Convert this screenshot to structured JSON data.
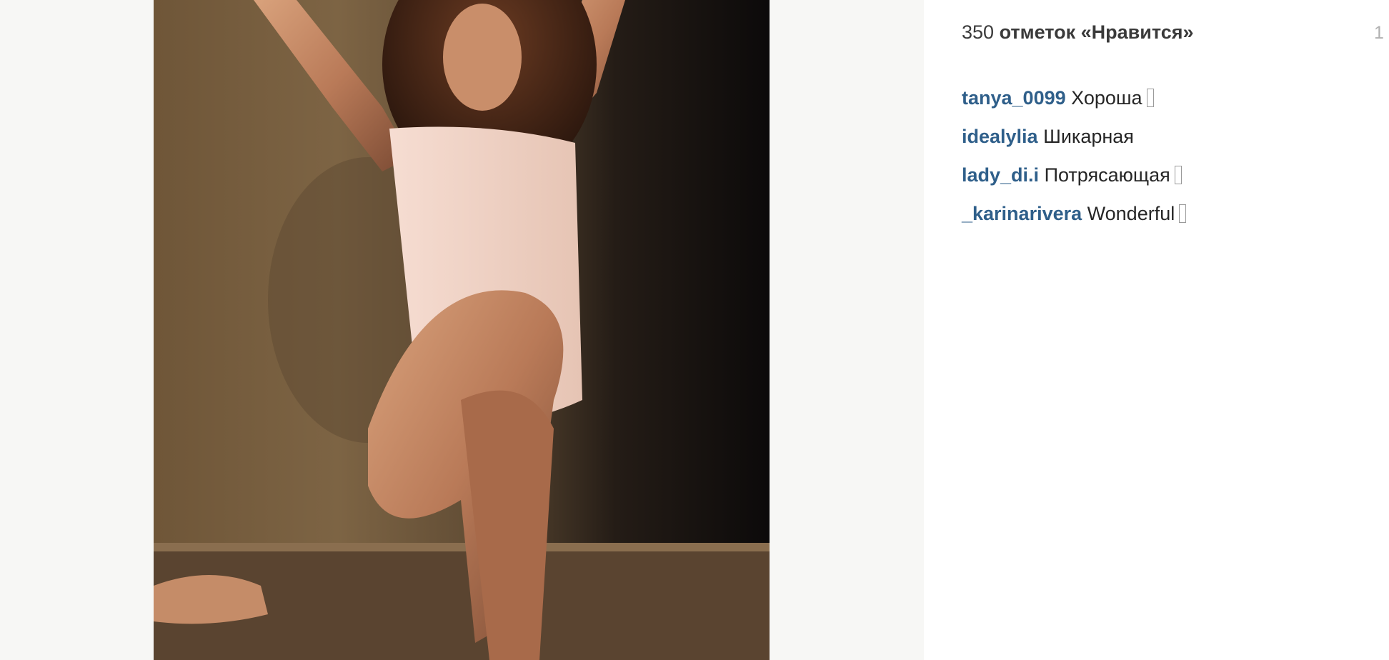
{
  "post": {
    "likes_count": "350",
    "likes_label": "отметок «Нравится»",
    "date_fragment": "1"
  },
  "comments": [
    {
      "user": "tanya_0099",
      "text": "Хороша",
      "emoji_box": true
    },
    {
      "user": "idealylia",
      "text": "Шикарная",
      "emoji_box": false
    },
    {
      "user": "lady_di.i",
      "text": "Потрясающая",
      "emoji_box": true
    },
    {
      "user": "_karinarivera",
      "text": "Wonderful",
      "emoji_box": true
    }
  ],
  "colors": {
    "username_link": "#2f5f8a",
    "text": "#262626",
    "photo_background": "#7d6444"
  }
}
